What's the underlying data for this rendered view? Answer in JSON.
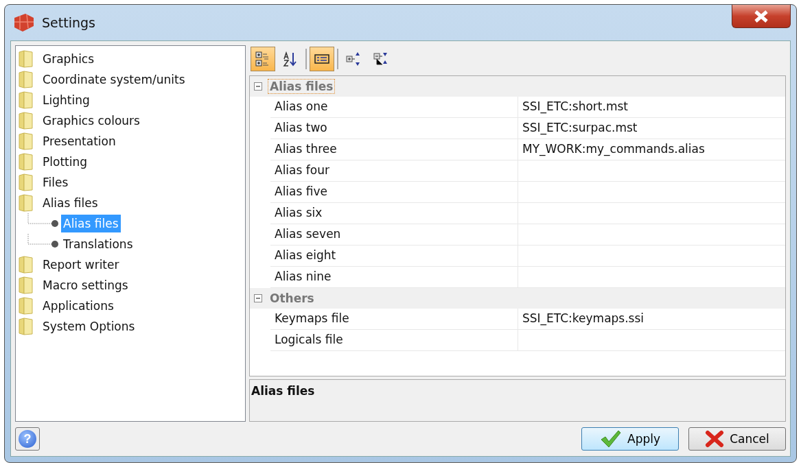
{
  "window": {
    "title": "Settings"
  },
  "tree": [
    {
      "label": "Graphics",
      "selected": false
    },
    {
      "label": "Coordinate system/units",
      "selected": false
    },
    {
      "label": "Lighting",
      "selected": false
    },
    {
      "label": "Graphics colours",
      "selected": false
    },
    {
      "label": "Presentation",
      "selected": false
    },
    {
      "label": "Plotting",
      "selected": false
    },
    {
      "label": "Files",
      "selected": false
    },
    {
      "label": "Alias files",
      "selected": false,
      "children": [
        {
          "label": "Alias files",
          "selected": true
        },
        {
          "label": "Translations",
          "selected": false
        }
      ]
    },
    {
      "label": "Report writer",
      "selected": false
    },
    {
      "label": "Macro settings",
      "selected": false
    },
    {
      "label": "Applications",
      "selected": false
    },
    {
      "label": "System Options",
      "selected": false
    }
  ],
  "toolbar": [
    {
      "kind": "categorized",
      "selected": true
    },
    {
      "kind": "alphabetical",
      "selected": false
    },
    {
      "kind": "separator"
    },
    {
      "kind": "pages",
      "selected": true
    },
    {
      "kind": "separator"
    },
    {
      "kind": "expand",
      "selected": false
    },
    {
      "kind": "collapse",
      "selected": false
    }
  ],
  "grid": [
    {
      "category": "Alias files",
      "expanded": true,
      "focused": true,
      "rows": [
        {
          "name": "Alias one",
          "value": "SSI_ETC:short.mst"
        },
        {
          "name": "Alias two",
          "value": "SSI_ETC:surpac.mst"
        },
        {
          "name": "Alias three",
          "value": "MY_WORK:my_commands.alias"
        },
        {
          "name": "Alias four"
        },
        {
          "name": "Alias five"
        },
        {
          "name": "Alias six"
        },
        {
          "name": "Alias seven"
        },
        {
          "name": "Alias eight"
        },
        {
          "name": "Alias nine"
        }
      ]
    },
    {
      "category": "Others",
      "expanded": true,
      "focused": false,
      "rows": [
        {
          "name": "Keymaps file",
          "value": "SSI_ETC:keymaps.ssi"
        },
        {
          "name": "Logicals file"
        }
      ]
    }
  ],
  "description": {
    "title": "Alias files"
  },
  "buttons": [
    {
      "kind": "apply",
      "label": "Apply"
    },
    {
      "kind": "cancel",
      "label": "Cancel"
    }
  ],
  "help_button": {
    "label": "?"
  }
}
